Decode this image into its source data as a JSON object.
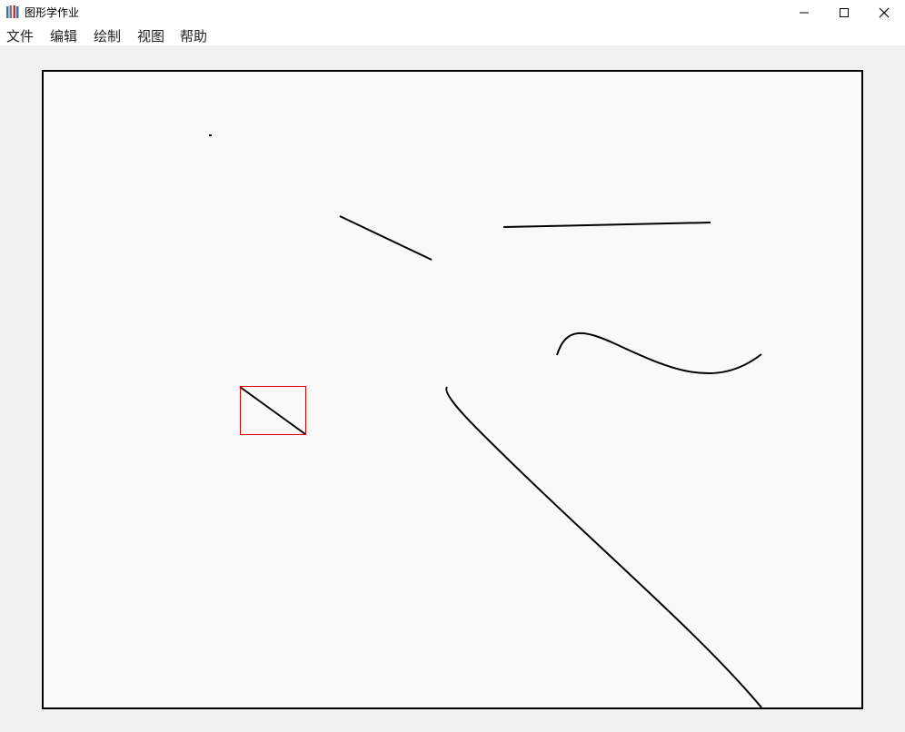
{
  "window": {
    "title": "图形学作业",
    "icon": "app-books-icon"
  },
  "titlebar_controls": {
    "minimize_icon": "minimize-icon",
    "maximize_icon": "maximize-icon",
    "close_icon": "close-icon"
  },
  "menu": {
    "items": [
      {
        "label": "文件"
      },
      {
        "label": "编辑"
      },
      {
        "label": "绘制"
      },
      {
        "label": "视图"
      },
      {
        "label": "帮助"
      }
    ]
  },
  "colors": {
    "stroke": "#000000",
    "selection": "#e00000",
    "canvas_bg": "#f9f9f9",
    "window_bg": "#f0f0f0"
  }
}
